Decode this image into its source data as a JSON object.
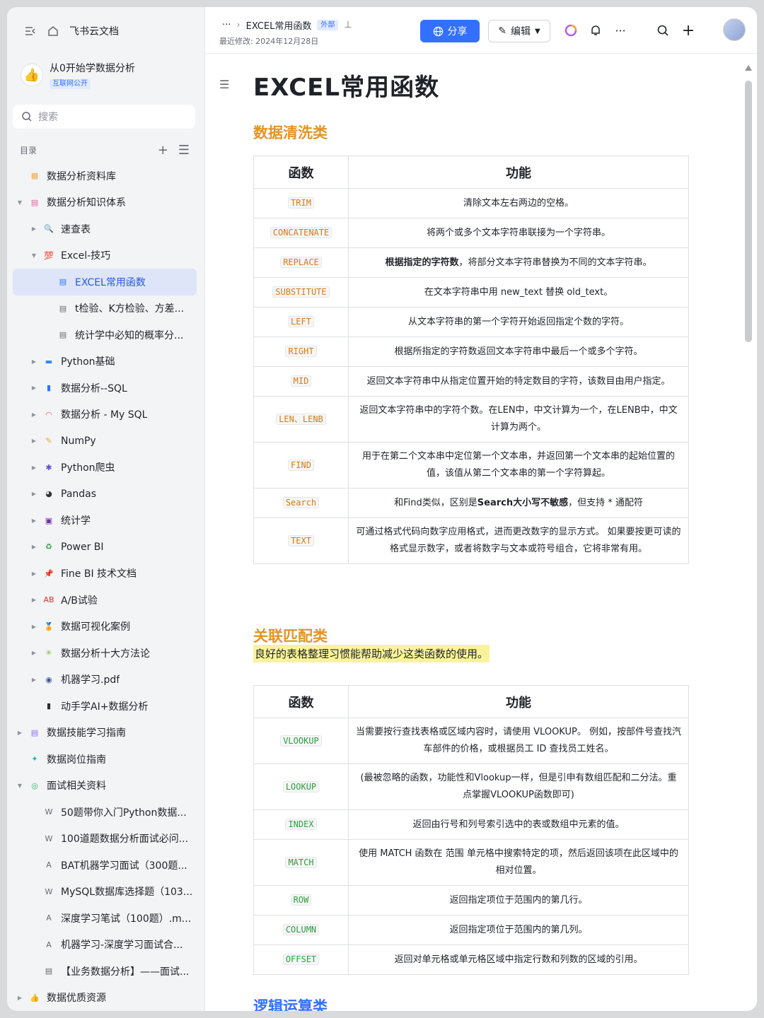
{
  "sidebar": {
    "app_name": "飞书云文档",
    "workspace": {
      "name": "从0开始学数据分析",
      "tag": "互联网公开"
    },
    "search_placeholder": "搜索",
    "toc_label": "目录",
    "items": [
      {
        "label": "数据分析资料库",
        "depth": 0,
        "arrow": "",
        "icon": "database-icon",
        "glyph": "▦",
        "color": "#f7a74a"
      },
      {
        "label": "数据分析知识体系",
        "depth": 0,
        "arrow": "▼",
        "icon": "knowledge-icon",
        "glyph": "▤",
        "color": "#e85ca0"
      },
      {
        "label": "速查表",
        "depth": 1,
        "arrow": "▶",
        "icon": "magnifier-icon",
        "glyph": "🔍",
        "color": "#3370ff"
      },
      {
        "label": "Excel-技巧",
        "depth": 1,
        "arrow": "▼",
        "icon": "hundred-icon",
        "glyph": "💯",
        "color": "#e0312c"
      },
      {
        "label": "EXCEL常用函数",
        "depth": 2,
        "arrow": "",
        "icon": "doc-icon",
        "glyph": "▤",
        "color": "#3370ff",
        "selected": true
      },
      {
        "label": "t检验、K方检验、方差...",
        "depth": 2,
        "arrow": "",
        "icon": "doc-icon",
        "glyph": "▤",
        "color": "#646a73"
      },
      {
        "label": "统计学中必知的概率分...",
        "depth": 2,
        "arrow": "",
        "icon": "doc-icon",
        "glyph": "▤",
        "color": "#646a73"
      },
      {
        "label": "Python基础",
        "depth": 1,
        "arrow": "▶",
        "icon": "laptop-icon",
        "glyph": "▬",
        "color": "#3b87f5"
      },
      {
        "label": "数据分析--SQL",
        "depth": 1,
        "arrow": "▶",
        "icon": "bar-chart-icon",
        "glyph": "▮",
        "color": "#3370ff"
      },
      {
        "label": "数据分析 - My SQL",
        "depth": 1,
        "arrow": "▶",
        "icon": "rainbow-icon",
        "glyph": "◠",
        "color": "#f25f3a"
      },
      {
        "label": "NumPy",
        "depth": 1,
        "arrow": "▶",
        "icon": "memo-icon",
        "glyph": "✎",
        "color": "#e8a23a"
      },
      {
        "label": "Python爬虫",
        "depth": 1,
        "arrow": "▶",
        "icon": "spider-icon",
        "glyph": "✱",
        "color": "#5a4fcf"
      },
      {
        "label": "Pandas",
        "depth": 1,
        "arrow": "▶",
        "icon": "panda-icon",
        "glyph": "◕",
        "color": "#333333"
      },
      {
        "label": "统计学",
        "depth": 1,
        "arrow": "▶",
        "icon": "floppy-icon",
        "glyph": "▣",
        "color": "#6b2fa0"
      },
      {
        "label": "Power BI",
        "depth": 1,
        "arrow": "▶",
        "icon": "recycle-icon",
        "glyph": "♻",
        "color": "#2ea043"
      },
      {
        "label": "Fine BI 技术文档",
        "depth": 1,
        "arrow": "▶",
        "icon": "pin-icon",
        "glyph": "📌",
        "color": "#e0312c"
      },
      {
        "label": "A/B试验",
        "depth": 1,
        "arrow": "▶",
        "icon": "ab-icon",
        "glyph": "AB",
        "color": "#e0312c"
      },
      {
        "label": "数据可视化案例",
        "depth": 1,
        "arrow": "▶",
        "icon": "medal-icon",
        "glyph": "🏅",
        "color": "#e8a23a"
      },
      {
        "label": "数据分析十大方法论",
        "depth": 1,
        "arrow": "▶",
        "icon": "sparkle-icon",
        "glyph": "✳",
        "color": "#7bc043"
      },
      {
        "label": "机器学习.pdf",
        "depth": 1,
        "arrow": "▶",
        "icon": "robot-icon",
        "glyph": "◉",
        "color": "#3b5998"
      },
      {
        "label": "动手学AI+数据分析",
        "depth": 1,
        "arrow": "",
        "icon": "traffic-light-icon",
        "glyph": "▮",
        "color": "#2b2b2b"
      },
      {
        "label": "数据技能学习指南",
        "depth": 0,
        "arrow": "▶",
        "icon": "guide-icon",
        "glyph": "▤",
        "color": "#8c6cf0"
      },
      {
        "label": "数据岗位指南",
        "depth": 0,
        "arrow": "",
        "icon": "job-icon",
        "glyph": "✦",
        "color": "#29b6a8"
      },
      {
        "label": "面试相关资料",
        "depth": 0,
        "arrow": "▼",
        "icon": "interview-icon",
        "glyph": "◎",
        "color": "#33b866"
      },
      {
        "label": "50题带你入门Python数据...",
        "depth": 1,
        "arrow": "",
        "icon": "word-file-icon",
        "glyph": "W",
        "color": "#646a73"
      },
      {
        "label": "100道题数据分析面试必问...",
        "depth": 1,
        "arrow": "",
        "icon": "word-file-icon",
        "glyph": "W",
        "color": "#646a73"
      },
      {
        "label": "BAT机器学习面试（300题...",
        "depth": 1,
        "arrow": "",
        "icon": "pdf-file-icon",
        "glyph": "A",
        "color": "#646a73"
      },
      {
        "label": "MySQL数据库选择题（103...",
        "depth": 1,
        "arrow": "",
        "icon": "word-file-icon",
        "glyph": "W",
        "color": "#646a73"
      },
      {
        "label": "深度学习笔试（100题）.m...",
        "depth": 1,
        "arrow": "",
        "icon": "pdf-file-icon",
        "glyph": "A",
        "color": "#646a73"
      },
      {
        "label": "机器学习-深度学习面试合...",
        "depth": 1,
        "arrow": "",
        "icon": "pdf-file-icon",
        "glyph": "A",
        "color": "#646a73"
      },
      {
        "label": "【业务数据分析】——面试...",
        "depth": 1,
        "arrow": "",
        "icon": "doc-icon",
        "glyph": "▤",
        "color": "#646a73"
      },
      {
        "label": "数据优质资源",
        "depth": 0,
        "arrow": "▶",
        "icon": "thumbs-up-icon",
        "glyph": "👍",
        "color": "#f5a623"
      }
    ]
  },
  "topbar": {
    "breadcrumb_more": "···",
    "doc_name": "EXCEL常用函数",
    "external_tag": "外部",
    "last_modified": "最近修改: 2024年12月28日",
    "share_label": "分享",
    "edit_label": "编辑"
  },
  "doc": {
    "title": "EXCEL常用函数",
    "sections": [
      {
        "heading": "数据清洗类"
      },
      {
        "heading": "关联匹配类",
        "note": "良好的表格整理习惯能帮助减少这类函数的使用。"
      },
      {
        "heading": "逻辑运算类"
      }
    ],
    "table_headers": {
      "fn": "函数",
      "desc": "功能"
    },
    "table1": [
      {
        "fn": "TRIM",
        "desc": "清除文本左右两边的空格。"
      },
      {
        "fn": "CONCATENATE",
        "desc": "将两个或多个文本字符串联接为一个字符串。"
      },
      {
        "fn": "REPLACE",
        "desc_bold": "根据指定的字符数",
        "desc": "，将部分文本字符串替换为不同的文本字符串。"
      },
      {
        "fn": "SUBSTITUTE",
        "desc": "在文本字符串中用 new_text 替换 old_text。"
      },
      {
        "fn": "LEFT",
        "desc": "从文本字符串的第一个字符开始返回指定个数的字符。"
      },
      {
        "fn": "RIGHT",
        "desc": "根据所指定的字符数返回文本字符串中最后一个或多个字符。"
      },
      {
        "fn": "MID",
        "desc": "返回文本字符串中从指定位置开始的特定数目的字符，该数目由用户指定。"
      },
      {
        "fn": "LEN、LENB",
        "desc": "返回文本字符串中的字符个数。在LEN中，中文计算为一个，在LENB中，中文计算为两个。"
      },
      {
        "fn": "FIND",
        "desc": "用于在第二个文本串中定位第一个文本串，并返回第一个文本串的起始位置的值，该值从第二个文本串的第一个字符算起。"
      },
      {
        "fn": "Search",
        "desc_pre": "和Find类似，区别是",
        "desc_bold": "Search大小写不敏感",
        "desc": "，但支持 * 通配符"
      },
      {
        "fn": "TEXT",
        "desc": "可通过格式代码向数字应用格式，进而更改数字的显示方式。 如果要按更可读的格式显示数字，或者将数字与文本或符号组合，它将非常有用。"
      }
    ],
    "table2": [
      {
        "fn": "VLOOKUP",
        "desc": "当需要按行查找表格或区域内容时，请使用 VLOOKUP。 例如，按部件号查找汽车部件的价格，或根据员工 ID 查找员工姓名。"
      },
      {
        "fn": "LOOKUP",
        "desc": "(最被忽略的函数，功能性和Vlookup一样，但是引申有数组匹配和二分法。重点掌握VLOOKUP函数即可)"
      },
      {
        "fn": "INDEX",
        "desc": "返回由行号和列号索引选中的表或数组中元素的值。"
      },
      {
        "fn": "MATCH",
        "desc": "使用 MATCH 函数在 范围 单元格中搜索特定的项，然后返回该项在此区域中的相对位置。"
      },
      {
        "fn": "ROW",
        "desc": "返回指定项位于范围内的第几行。"
      },
      {
        "fn": "COLUMN",
        "desc": "返回指定项位于范围内的第几列。"
      },
      {
        "fn": "OFFSET",
        "desc": "返回对单元格或单元格区域中指定行数和列数的区域的引用。"
      }
    ],
    "colors": {
      "heading": "#e59423",
      "code_orange": "#d97b12",
      "code_green": "#2e9e3e",
      "accent": "#3370ff",
      "note_bg": "#fbf39b"
    }
  }
}
